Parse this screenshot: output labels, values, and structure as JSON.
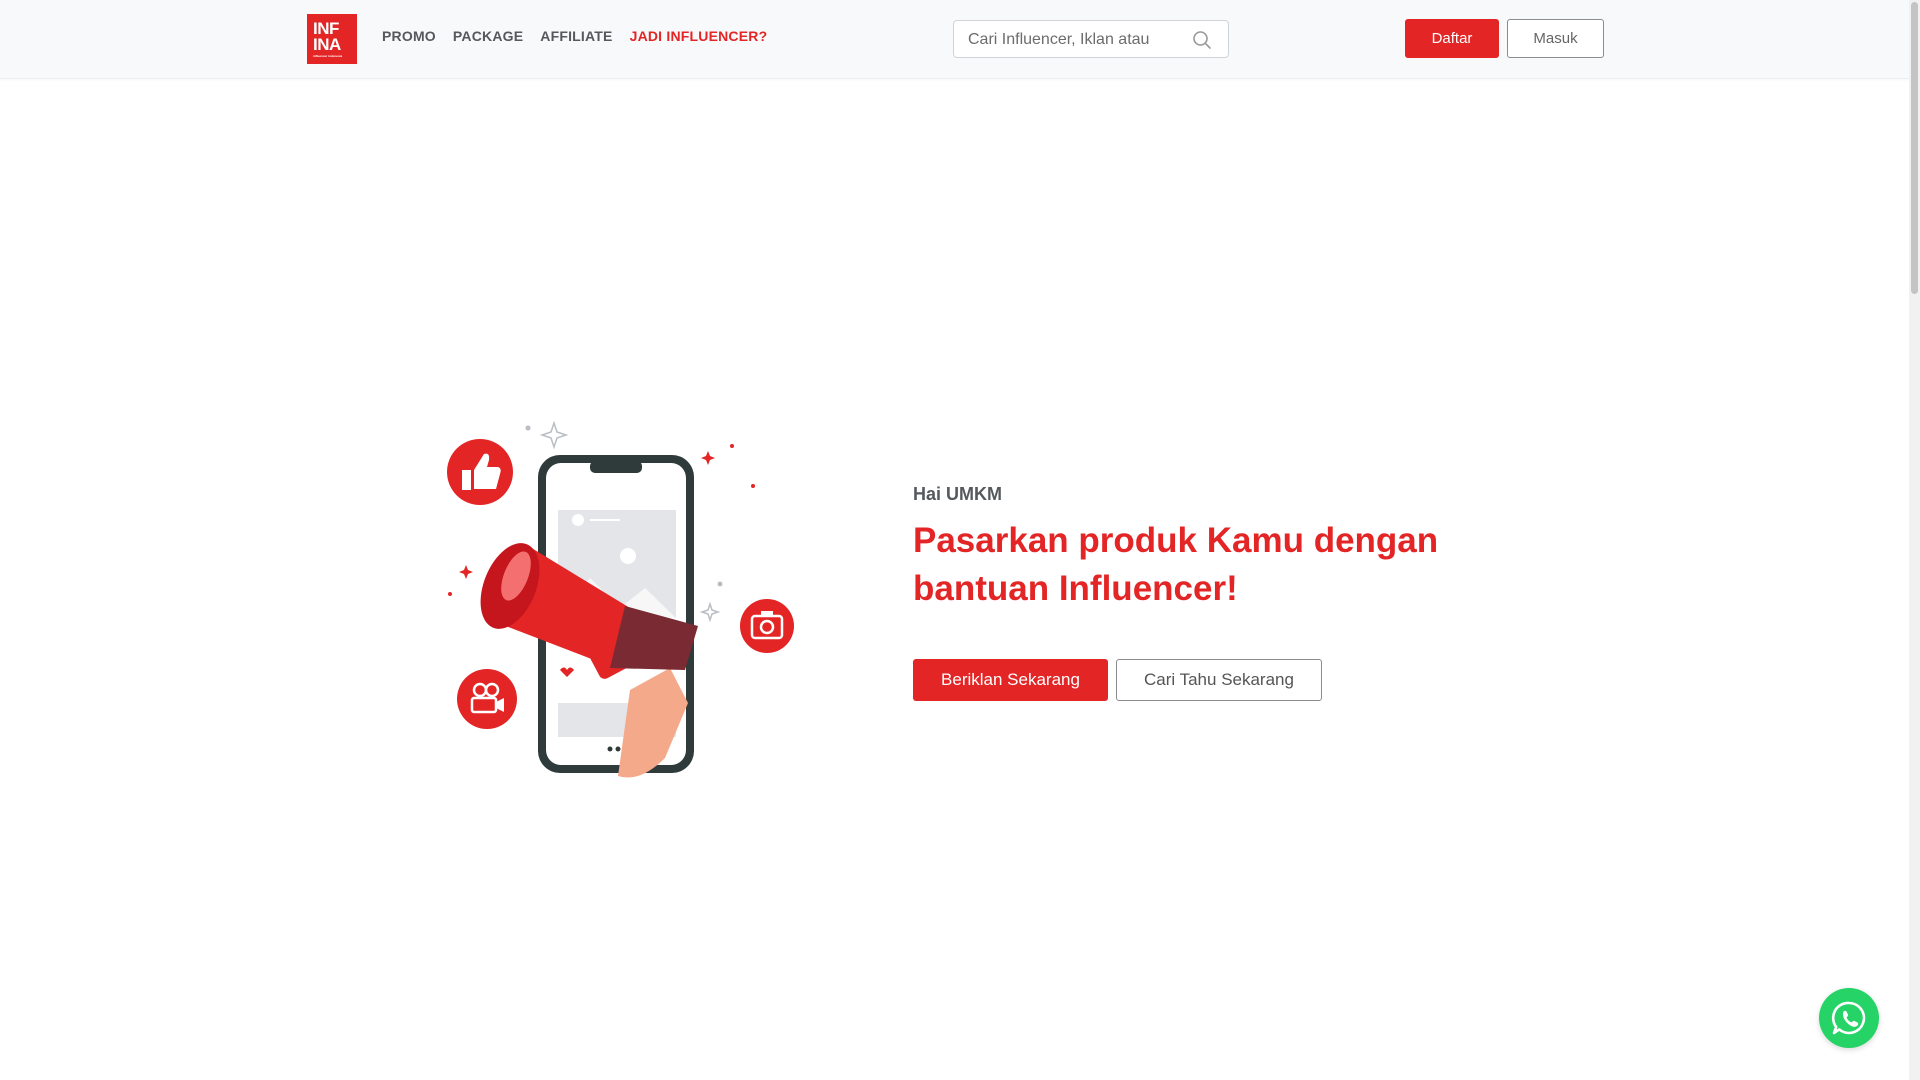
{
  "header": {
    "logo": {
      "line1": "INF",
      "line2": "INA",
      "tagline": "influencer indonesia"
    },
    "nav": [
      {
        "label": "PROMO"
      },
      {
        "label": "PACKAGE"
      },
      {
        "label": "AFFILIATE"
      },
      {
        "label": "JADI INFLUENCER?",
        "accent": true
      }
    ],
    "search": {
      "placeholder": "Cari Influencer, Iklan atau",
      "icon": "search-icon"
    },
    "register_label": "Daftar",
    "login_label": "Masuk"
  },
  "hero": {
    "subtitle": "Hai UMKM",
    "title": "Pasarkan produk Kamu dengan bantuan Influencer!",
    "primary_button": "Beriklan Sekarang",
    "secondary_button": "Cari Tahu Sekarang",
    "illustration": "megaphone-phone-illustration"
  },
  "floating": {
    "icon": "whatsapp-icon"
  },
  "colors": {
    "accent": "#e32526",
    "whatsapp": "#25d366",
    "text": "#55595c"
  }
}
